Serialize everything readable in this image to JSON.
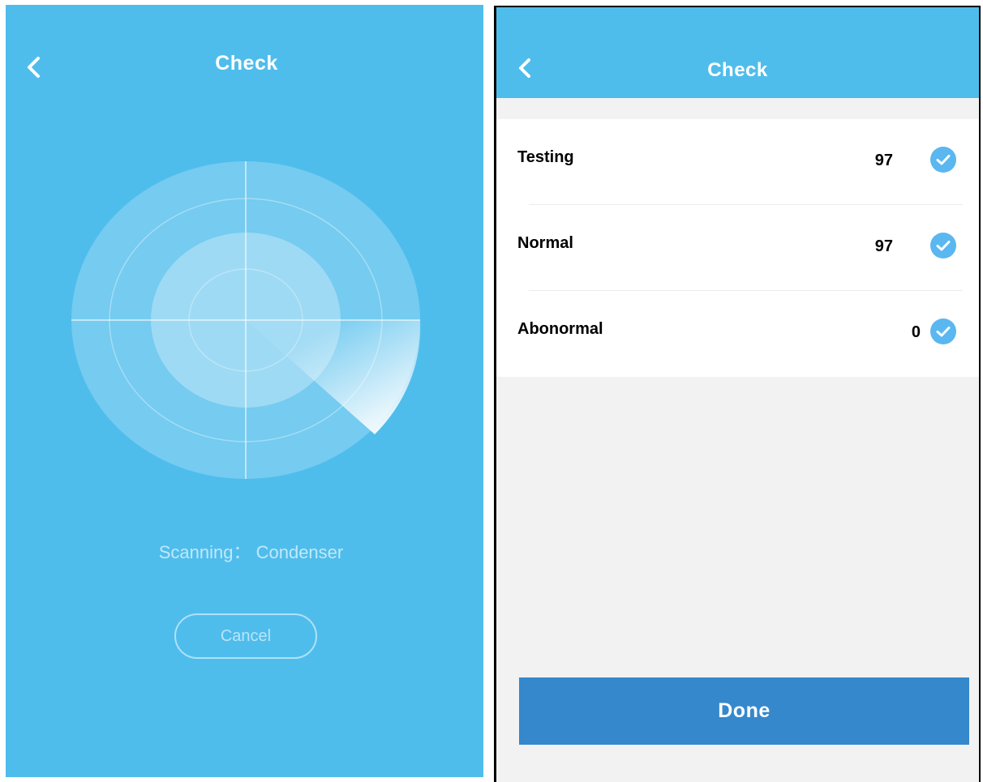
{
  "scan_screen": {
    "title": "Check",
    "status_text": "Scanning： Condenser",
    "cancel_label": "Cancel",
    "icons": {
      "back": "chevron-left-icon"
    }
  },
  "result_screen": {
    "title": "Check",
    "icons": {
      "back": "chevron-left-icon",
      "check": "check-circle-icon"
    },
    "rows": [
      {
        "label": "Testing",
        "value": "97"
      },
      {
        "label": "Normal",
        "value": "97"
      },
      {
        "label": "Abonormal",
        "value": "0"
      }
    ],
    "done_label": "Done"
  },
  "colors": {
    "primary": "#4fbdec",
    "button": "#3588cc",
    "check": "#5ab7ef",
    "background": "#f2f2f2"
  }
}
